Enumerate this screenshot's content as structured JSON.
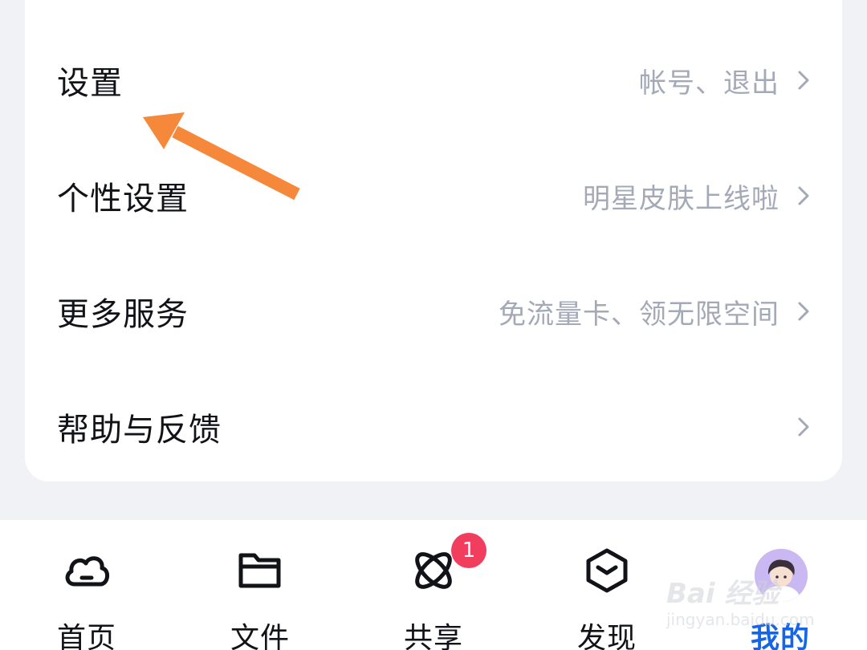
{
  "menu": {
    "items": [
      {
        "title": "设置",
        "subtitle": "帐号、退出"
      },
      {
        "title": "个性设置",
        "subtitle": "明星皮肤上线啦"
      },
      {
        "title": "更多服务",
        "subtitle": "免流量卡、领无限空间"
      },
      {
        "title": "帮助与反馈",
        "subtitle": ""
      }
    ]
  },
  "tabbar": {
    "tabs": [
      {
        "label": "首页",
        "icon": "cloud-icon"
      },
      {
        "label": "文件",
        "icon": "folder-icon"
      },
      {
        "label": "共享",
        "icon": "orbit-icon"
      },
      {
        "label": "发现",
        "icon": "cube-icon"
      },
      {
        "label": "我的",
        "icon": "avatar"
      }
    ],
    "active_index": 4,
    "share_badge": "1"
  },
  "watermark": {
    "logo": "Bai 经验",
    "url": "jingyan.baidu.com"
  },
  "colors": {
    "accent": "#1565e9",
    "badge": "#f23e5e",
    "annotation_arrow": "#f5883a",
    "background": "#f1f2f6"
  }
}
